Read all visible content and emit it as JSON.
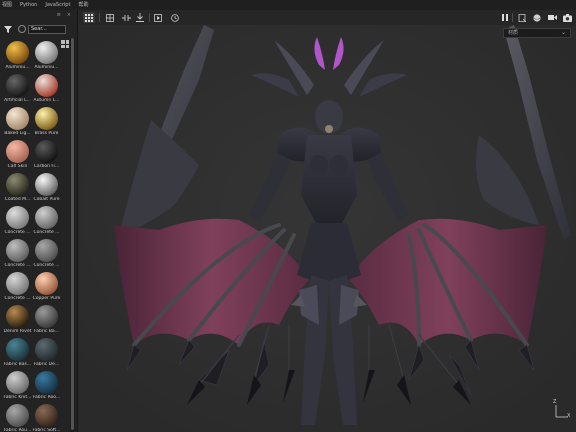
{
  "menubar": {
    "items": [
      "视图",
      "Python",
      "JavaScript",
      "帮助"
    ]
  },
  "panel": {
    "header_icons": [
      "≡",
      "×"
    ]
  },
  "search": {
    "value": "Sear..."
  },
  "materials": [
    {
      "label": "Aluminiu...",
      "color_a": "#f2c04a",
      "color_b": "#6a3a06"
    },
    {
      "label": "Aluminiu...",
      "color_a": "#f0f0f0",
      "color_b": "#6a6a6a"
    },
    {
      "label": "Artificial L...",
      "color_a": "#666666",
      "color_b": "#0c0c0c"
    },
    {
      "label": "Autumn L...",
      "color_a": "#e8e0d8",
      "color_b": "#a02818"
    },
    {
      "label": "Baked Lig...",
      "color_a": "#f5e6d2",
      "color_b": "#9a7c5c"
    },
    {
      "label": "Brass Pure",
      "color_a": "#fff1a8",
      "color_b": "#6c4e08"
    },
    {
      "label": "Calf Skin",
      "color_a": "#f6b8a4",
      "color_b": "#9c5a48"
    },
    {
      "label": "Carbon Fi...",
      "color_a": "#5a5a5a",
      "color_b": "#0a0a0a"
    },
    {
      "label": "Coated M...",
      "color_a": "#8e8a70",
      "color_b": "#1c1c14"
    },
    {
      "label": "Cobalt Pure",
      "color_a": "#f8f8f8",
      "color_b": "#505050"
    },
    {
      "label": "Concrete ...",
      "color_a": "#dedede",
      "color_b": "#6e6e6e"
    },
    {
      "label": "Concrete ...",
      "color_a": "#cfcfcf",
      "color_b": "#5a5a5a"
    },
    {
      "label": "Concrete ...",
      "color_a": "#bfbfbf",
      "color_b": "#525252"
    },
    {
      "label": "Concrete ...",
      "color_a": "#a8a8a8",
      "color_b": "#444444"
    },
    {
      "label": "Concrete ...",
      "color_a": "#d6d6d6",
      "color_b": "#6a6a6a"
    },
    {
      "label": "Copper Pure",
      "color_a": "#ffd0b0",
      "color_b": "#8a4a2c"
    },
    {
      "label": "Denim Rivet",
      "color_a": "#b88a50",
      "color_b": "#1a1208"
    },
    {
      "label": "Fabric Ba...",
      "color_a": "#9a9a9a",
      "color_b": "#2e2e2e"
    },
    {
      "label": "Fabric Bas...",
      "color_a": "#4a8494",
      "color_b": "#152a32"
    },
    {
      "label": "Fabric De...",
      "color_a": "#5a6a70",
      "color_b": "#1c2428"
    },
    {
      "label": "Fabric Knit...",
      "color_a": "#cfcfcf",
      "color_b": "#5e5e5e"
    },
    {
      "label": "Fabric Roo...",
      "color_a": "#3a7aa0",
      "color_b": "#10283a"
    },
    {
      "label": "Fabric Rou...",
      "color_a": "#a8a8a8",
      "color_b": "#444444"
    },
    {
      "label": "Fabric Soft...",
      "color_a": "#8a6a56",
      "color_b": "#2a1c14"
    }
  ],
  "toolbar": {
    "left_icons": [
      "grid-view-icon",
      "camera-grid-icon",
      "split-view-icon",
      "align-icon",
      "render-icon",
      "history-icon"
    ],
    "right_icons": [
      "pause-icon",
      "canvas-icon",
      "sphere-icon",
      "video-icon",
      "screenshot-icon"
    ]
  },
  "viewport": {
    "dropdown_value": "材质",
    "axis_labels": {
      "z": "Z",
      "x": "X"
    }
  },
  "colors": {
    "background": "#2e2e2e",
    "panel": "#232323",
    "wing_membrane": "#7a3a55",
    "armor": "#2a2a34"
  }
}
